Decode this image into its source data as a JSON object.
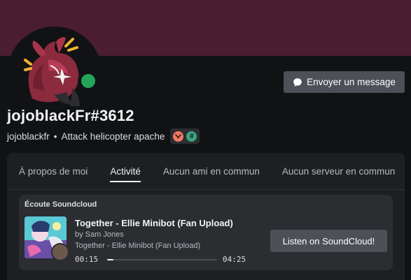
{
  "profile": {
    "banner_color": "#4a1d30",
    "status": "online",
    "status_color": "#23a559",
    "username": "jojoblackFr#3612",
    "handle": "jojoblackfr",
    "separator": "•",
    "custom_status": "Attack helicopter apache",
    "badges": [
      {
        "icon": "heart-chevron-badge-icon",
        "color": "#f37a62"
      },
      {
        "icon": "hashtag-badge-icon",
        "color": "#3ba57d",
        "glyph": "#"
      }
    ]
  },
  "actions": {
    "send_message_label": "Envoyer un message",
    "send_message_icon": "chat-bubble-icon"
  },
  "tabs": [
    {
      "label": "À propos de moi",
      "active": false
    },
    {
      "label": "Activité",
      "active": true
    },
    {
      "label": "Aucun ami en commun",
      "active": false
    },
    {
      "label": "Aucun serveur en commun",
      "active": false
    }
  ],
  "activity": {
    "header": "Écoute Soundcloud",
    "title": "Together - Ellie Minibot (Fan Upload)",
    "artist": "by Sam Jones",
    "album": "Together - Ellie Minibot (Fan Upload)",
    "elapsed": "00:15",
    "total": "04:25",
    "progress_fraction": 0.057,
    "button_label": "Listen on SoundCloud!"
  }
}
